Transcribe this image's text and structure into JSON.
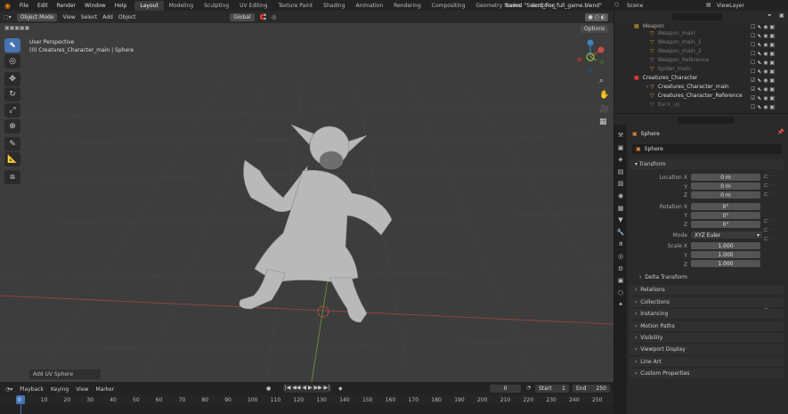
{
  "menu": {
    "file": "File",
    "edit": "Edit",
    "render": "Render",
    "window": "Window",
    "help": "Help"
  },
  "workspaces": [
    "Layout",
    "Modeling",
    "Sculpting",
    "UV Editing",
    "Texture Paint",
    "Shading",
    "Animation",
    "Rendering",
    "Compositing",
    "Geometry Nodes",
    "Scripting"
  ],
  "title": "Saved \"Sword_For_full_game.blend\"",
  "scene": "Scene",
  "view_layer": "ViewLayer",
  "header": {
    "mode": "Object Mode",
    "view": "View",
    "select": "Select",
    "add": "Add",
    "object": "Object",
    "orientation": "Global",
    "options": "Options"
  },
  "viewport": {
    "perspective": "User Perspective",
    "collection": "(0) Creatures_Character_main | Sphere",
    "last_op": "Add UV Sphere"
  },
  "outliner": {
    "search_placeholder": "",
    "items": [
      {
        "label": "Weapon",
        "color": "#c9a227"
      },
      {
        "label": "Weapon_main"
      },
      {
        "label": "Weapon_main_1"
      },
      {
        "label": "Weapon_main_2"
      },
      {
        "label": "Weapon_Reference"
      },
      {
        "label": "Spider_main"
      },
      {
        "label": "Creatures_Character"
      },
      {
        "label": "Creatures_Character_main"
      },
      {
        "label": "Creatures_Character_Reference"
      },
      {
        "label": "Back_up"
      }
    ]
  },
  "props": {
    "object_name": "Sphere",
    "data_name": "Sphere",
    "transform": "Transform",
    "location_label": "Location X",
    "loc": [
      "0 m",
      "0 m",
      "0 m"
    ],
    "rotation_label": "Rotation X",
    "rot": [
      "0°",
      "0°",
      "0°"
    ],
    "mode_label": "Mode",
    "mode": "XYZ Euler",
    "scale_label": "Scale X",
    "scale": [
      "1.000",
      "1.000",
      "1.000"
    ],
    "axis_y": "Y",
    "axis_z": "Z",
    "delta": "Delta Transform",
    "sections": [
      "Relations",
      "Collections",
      "Instancing",
      "Motion Paths",
      "Visibility",
      "Viewport Display",
      "Line Art",
      "Custom Properties"
    ]
  },
  "timeline": {
    "playback": "Playback",
    "keying": "Keying",
    "view": "View",
    "marker": "Marker",
    "current": "0",
    "start_label": "Start",
    "start": "1",
    "end_label": "End",
    "end": "250",
    "ticks": [
      "0",
      "10",
      "20",
      "30",
      "40",
      "50",
      "60",
      "70",
      "80",
      "90",
      "100",
      "110",
      "120",
      "130",
      "140",
      "150",
      "160",
      "170",
      "180",
      "190",
      "200",
      "210",
      "220",
      "230",
      "240",
      "250"
    ]
  },
  "colors": {
    "accent": "#4772b3",
    "x_axis": "#c94b4b",
    "y_axis": "#7fb03f",
    "z_axis": "#3a82c4"
  }
}
